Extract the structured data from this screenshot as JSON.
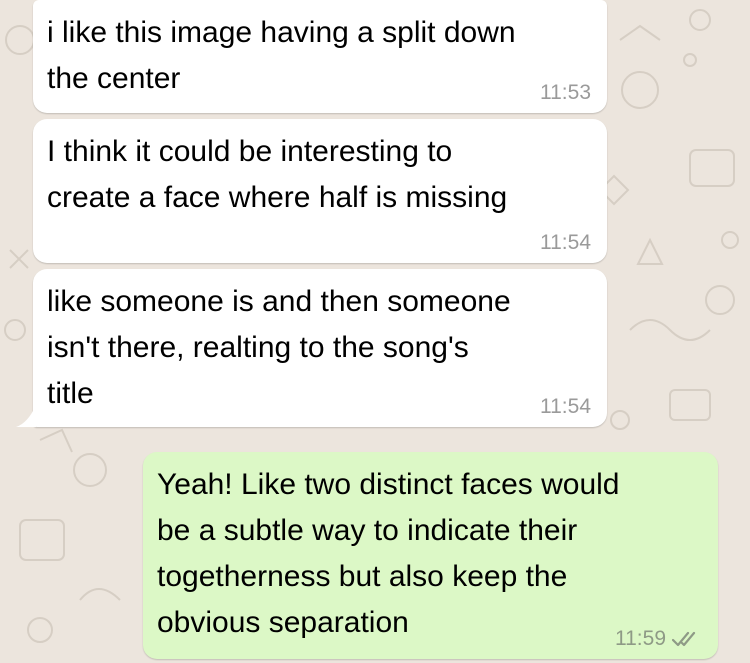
{
  "colors": {
    "wallpaper": "#ece5dd",
    "incoming_bubble": "#ffffff",
    "outgoing_bubble": "#dcf8c6",
    "timestamp_incoming": "#9a9a9a",
    "timestamp_outgoing": "#8e9a86",
    "read_ticks": "#8e9a86"
  },
  "messages": [
    {
      "direction": "incoming",
      "text": "i like this image having a split down\nthe center",
      "time": "11:53"
    },
    {
      "direction": "incoming",
      "text": "I think it could be interesting to\ncreate a face where half is missing",
      "time": "11:54"
    },
    {
      "direction": "incoming",
      "text": "like someone is and then someone\nisn't there, realting to the song's\ntitle",
      "time": "11:54"
    },
    {
      "direction": "outgoing",
      "text": "Yeah! Like two distinct faces would\nbe a subtle way to indicate their\ntogetherness but also keep the\nobvious separation",
      "time": "11:59",
      "status_icon": "double-check-icon"
    }
  ]
}
